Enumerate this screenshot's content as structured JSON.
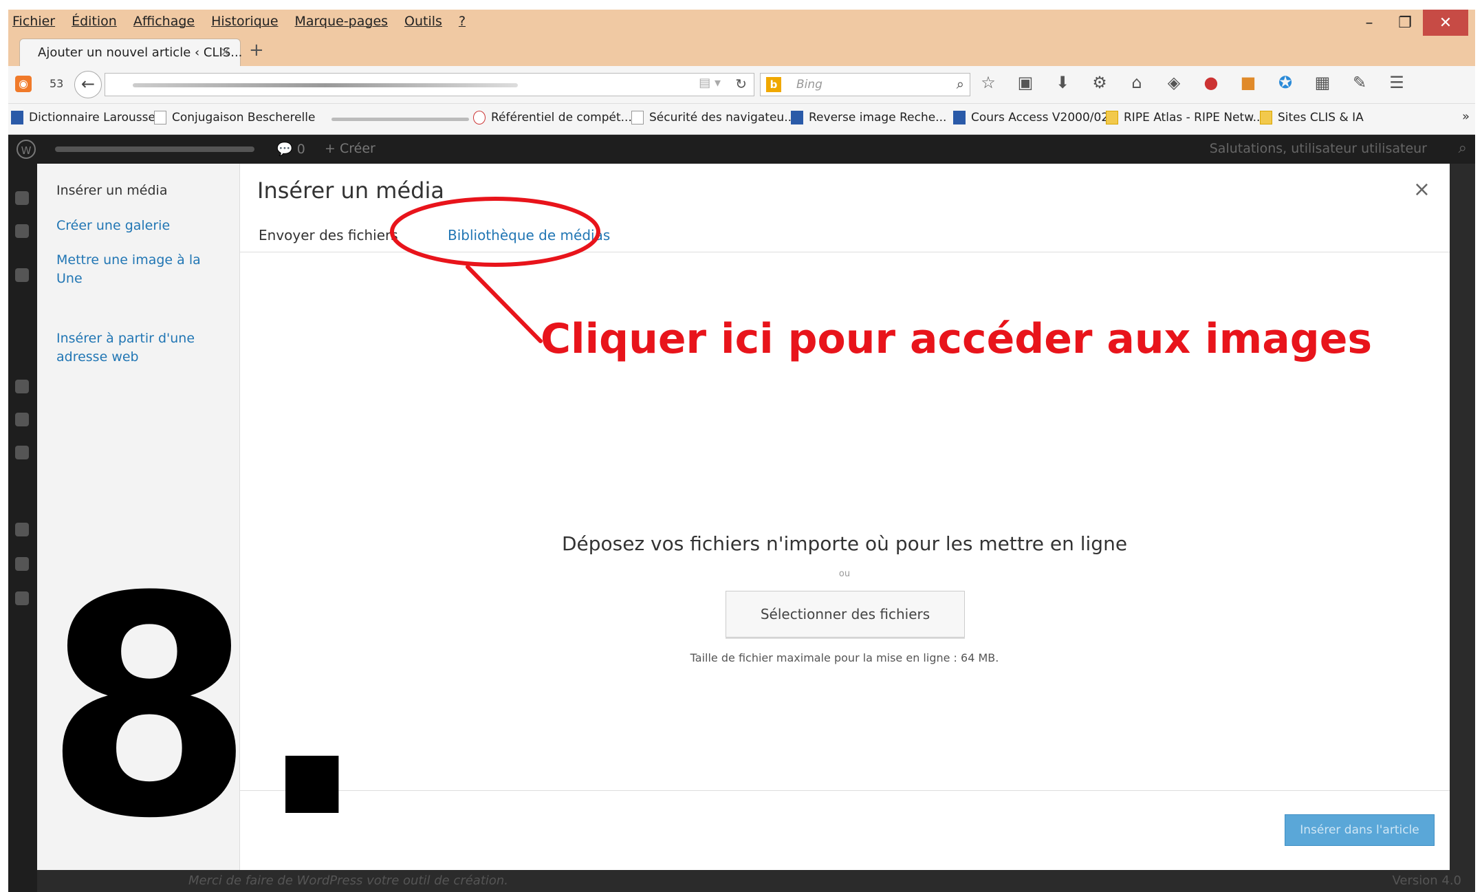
{
  "browser": {
    "menus": [
      "Fichier",
      "Édition",
      "Affichage",
      "Historique",
      "Marque-pages",
      "Outils",
      "?"
    ],
    "window_controls": {
      "minimize": "–",
      "maximize": "❐",
      "close": "✕"
    },
    "tab_title": "Ajouter un nouvel article ‹ CLIS...",
    "tab_close": "×",
    "new_tab": "+",
    "tab_count": "53",
    "search_placeholder": "Bing",
    "bookmarks": [
      "Dictionnaire Larousse",
      "Conjugaison Bescherelle",
      "Référentiel de compét...",
      "Sécurité des navigateu...",
      "Reverse image Reche...",
      "Cours Access V2000/02",
      "RIPE Atlas - RIPE Netw...",
      "Sites CLIS & IA"
    ],
    "bookmarks_more": "»"
  },
  "wp": {
    "comments_count": "0",
    "create_label": "Créer",
    "greeting": "Salutations, utilisateur utilisateur",
    "footer_text": "Merci de faire de WordPress votre outil de création.",
    "version": "Version 4.0"
  },
  "modal": {
    "title": "Insérer un média",
    "close": "×",
    "sidebar": [
      "Insérer un média",
      "Créer une galerie",
      "Mettre une image à la Une",
      "Insérer à partir d'une adresse web"
    ],
    "tabs": {
      "upload": "Envoyer des fichiers",
      "library": "Bibliothèque de médias"
    },
    "drop_text": "Déposez vos fichiers n'importe où pour les mettre en ligne",
    "or_text": "ou",
    "select_button": "Sélectionner des fichiers",
    "max_size": "Taille de fichier maximale pour la mise en ligne : 64 MB.",
    "insert_button": "Insérer dans l'article"
  },
  "annotation": {
    "callout": "Cliquer ici pour accéder aux images",
    "step": "8.",
    "color": "#e8141b"
  }
}
